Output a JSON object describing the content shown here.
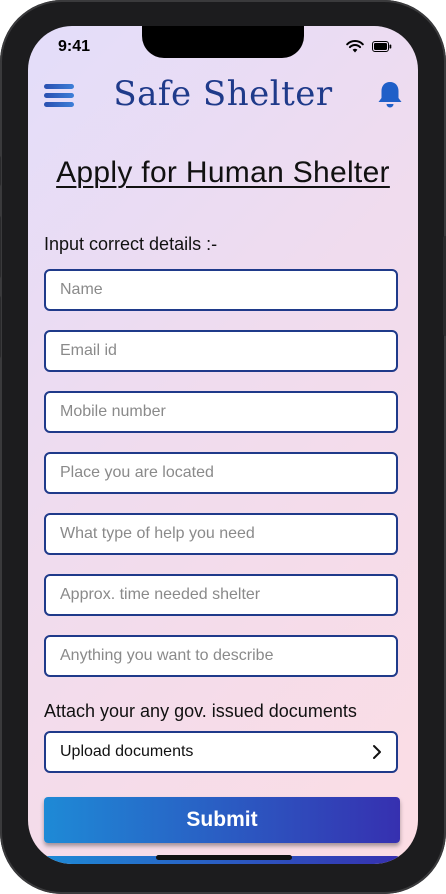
{
  "status": {
    "time": "9:41"
  },
  "header": {
    "title": "Safe Shelter"
  },
  "page": {
    "heading": "Apply for Human Shelter",
    "instructions": "Input correct details :-"
  },
  "form": {
    "name_placeholder": "Name",
    "email_placeholder": "Email id",
    "mobile_placeholder": "Mobile number",
    "location_placeholder": "Place you are located",
    "help_type_placeholder": "What type of help you need",
    "time_needed_placeholder": "Approx. time needed shelter",
    "description_placeholder": "Anything you want to describe"
  },
  "documents": {
    "label": "Attach your any gov. issued documents",
    "upload_label": "Upload documents"
  },
  "actions": {
    "submit_label": "Submit"
  },
  "colors": {
    "accent": "#1f3a8a",
    "button_start": "#1e8ad6",
    "button_end": "#3630b0",
    "bell": "#1f5fc8"
  }
}
